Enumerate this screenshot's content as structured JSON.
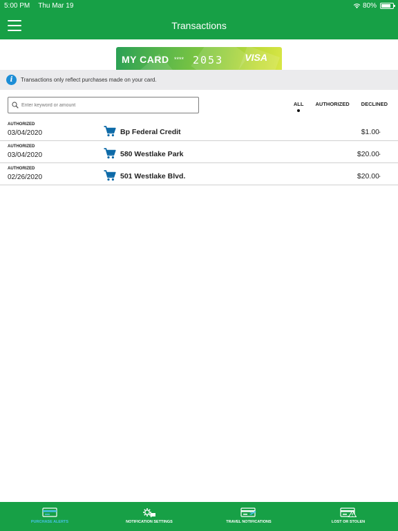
{
  "status_bar": {
    "time": "5:00 PM",
    "date": "Thu Mar 19",
    "battery": "80%",
    "battery_level": 0.8
  },
  "header": {
    "title": "Transactions",
    "menu_icon": "hamburger-icon"
  },
  "card": {
    "label": "MY CARD",
    "masked": "****",
    "last4": "2053",
    "brand": "VISA"
  },
  "notice": {
    "icon": "info-icon",
    "text": "Transactions only reflect purchases made on your card."
  },
  "search": {
    "placeholder": "Enter keyword or amount",
    "value": ""
  },
  "filters": [
    {
      "label": "ALL",
      "selected": true
    },
    {
      "label": "AUTHORIZED",
      "selected": false
    },
    {
      "label": "DECLINED",
      "selected": false
    }
  ],
  "transactions": [
    {
      "status": "AUTHORIZED",
      "date": "03/04/2020",
      "merchant": "Bp Federal Credit",
      "amount": "$1.00"
    },
    {
      "status": "AUTHORIZED",
      "date": "03/04/2020",
      "merchant": "580 Westlake Park",
      "amount": "$20.00"
    },
    {
      "status": "AUTHORIZED",
      "date": "02/26/2020",
      "merchant": "501 Westlake Blvd.",
      "amount": "$20.00"
    }
  ],
  "tabs": [
    {
      "label": "PURCHASE ALERTS",
      "icon": "card-icon",
      "active": true
    },
    {
      "label": "NOTIFICATION SETTINGS",
      "icon": "gear-chat-icon",
      "active": false
    },
    {
      "label": "TRAVEL NOTIFICATIONS",
      "icon": "card-plane-icon",
      "active": false
    },
    {
      "label": "LOST OR STOLEN",
      "icon": "card-alert-icon",
      "active": false
    }
  ],
  "colors": {
    "brand_green": "#17a046",
    "info_blue": "#1d8ed6",
    "cart_blue": "#0d6aa8",
    "active_tab": "#48c3e8"
  }
}
